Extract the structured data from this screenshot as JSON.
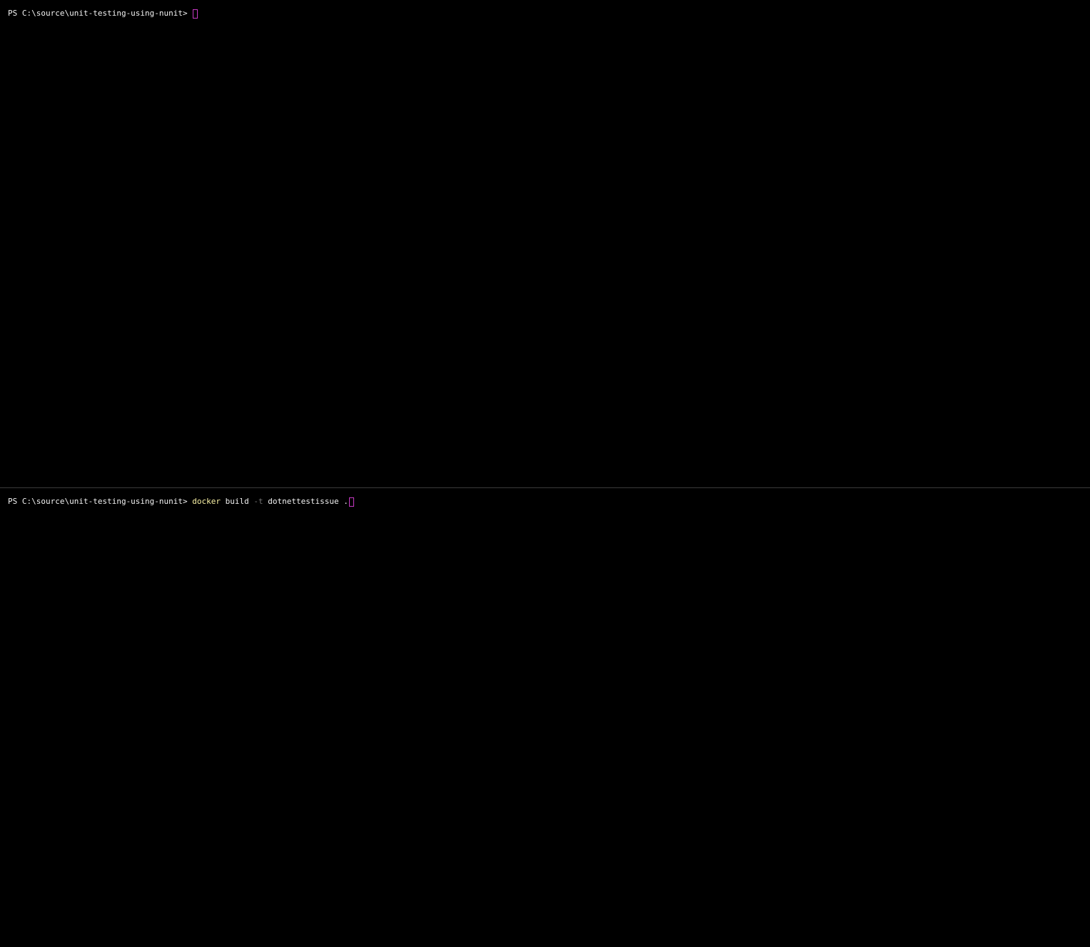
{
  "colors": {
    "background": "#000000",
    "foreground": "#f2f2f2",
    "command": "#f9f1a5",
    "parameter": "#767676",
    "cursor": "#c839c5",
    "divider": "#3a3a3a"
  },
  "panes": [
    {
      "prompt": "PS C:\\source\\unit-testing-using-nunit> ",
      "input": ""
    },
    {
      "prompt": "PS C:\\source\\unit-testing-using-nunit> ",
      "command": "docker",
      "arg1": " build ",
      "flag": "-t",
      "arg2": " dotnettestissue .",
      "input": "docker build -t dotnettestissue ."
    }
  ]
}
